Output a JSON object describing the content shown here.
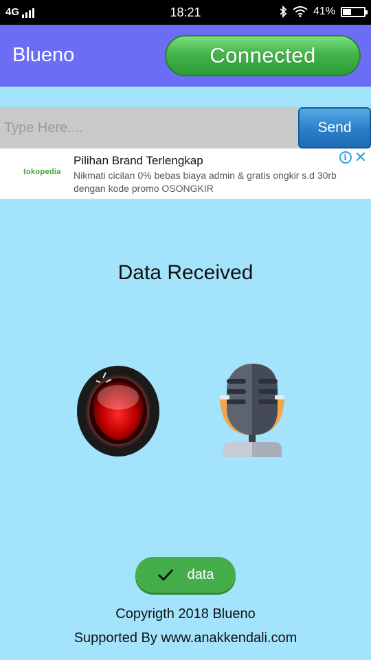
{
  "status_bar": {
    "network": "4G",
    "time": "18:21",
    "battery_percent": "41%",
    "battery_level": 0.41,
    "icons": [
      "signal-icon",
      "bluetooth-icon",
      "wifi-icon",
      "battery-icon"
    ]
  },
  "app_bar": {
    "title": "Blueno",
    "status_label": "Connected",
    "status_color": "#45b34a",
    "bar_color": "#6b6ef5"
  },
  "input": {
    "placeholder": "Type Here....",
    "value": "",
    "send_label": "Send"
  },
  "ad": {
    "brand_logo_text": "tokopedia",
    "headline": "Pilihan Brand Terlengkap",
    "body": "Nikmati cicilan 0% bebas biaya admin & gratis ongkir s.d 30rb dengan kode promo OSONGKIR",
    "icons": [
      "ad-info-icon",
      "ad-close-icon"
    ]
  },
  "main": {
    "heading": "Data Received",
    "icons": [
      "red-record-button-icon",
      "microphone-icon"
    ],
    "data_button_label": "data"
  },
  "footer": {
    "copyright": "Copyrigth 2018 Blueno",
    "supported": "Supported By www.anakkendali.com"
  },
  "colors": {
    "background": "#a3e4fc",
    "send_button": "#2a7fc9",
    "data_button": "#45ae4b"
  }
}
